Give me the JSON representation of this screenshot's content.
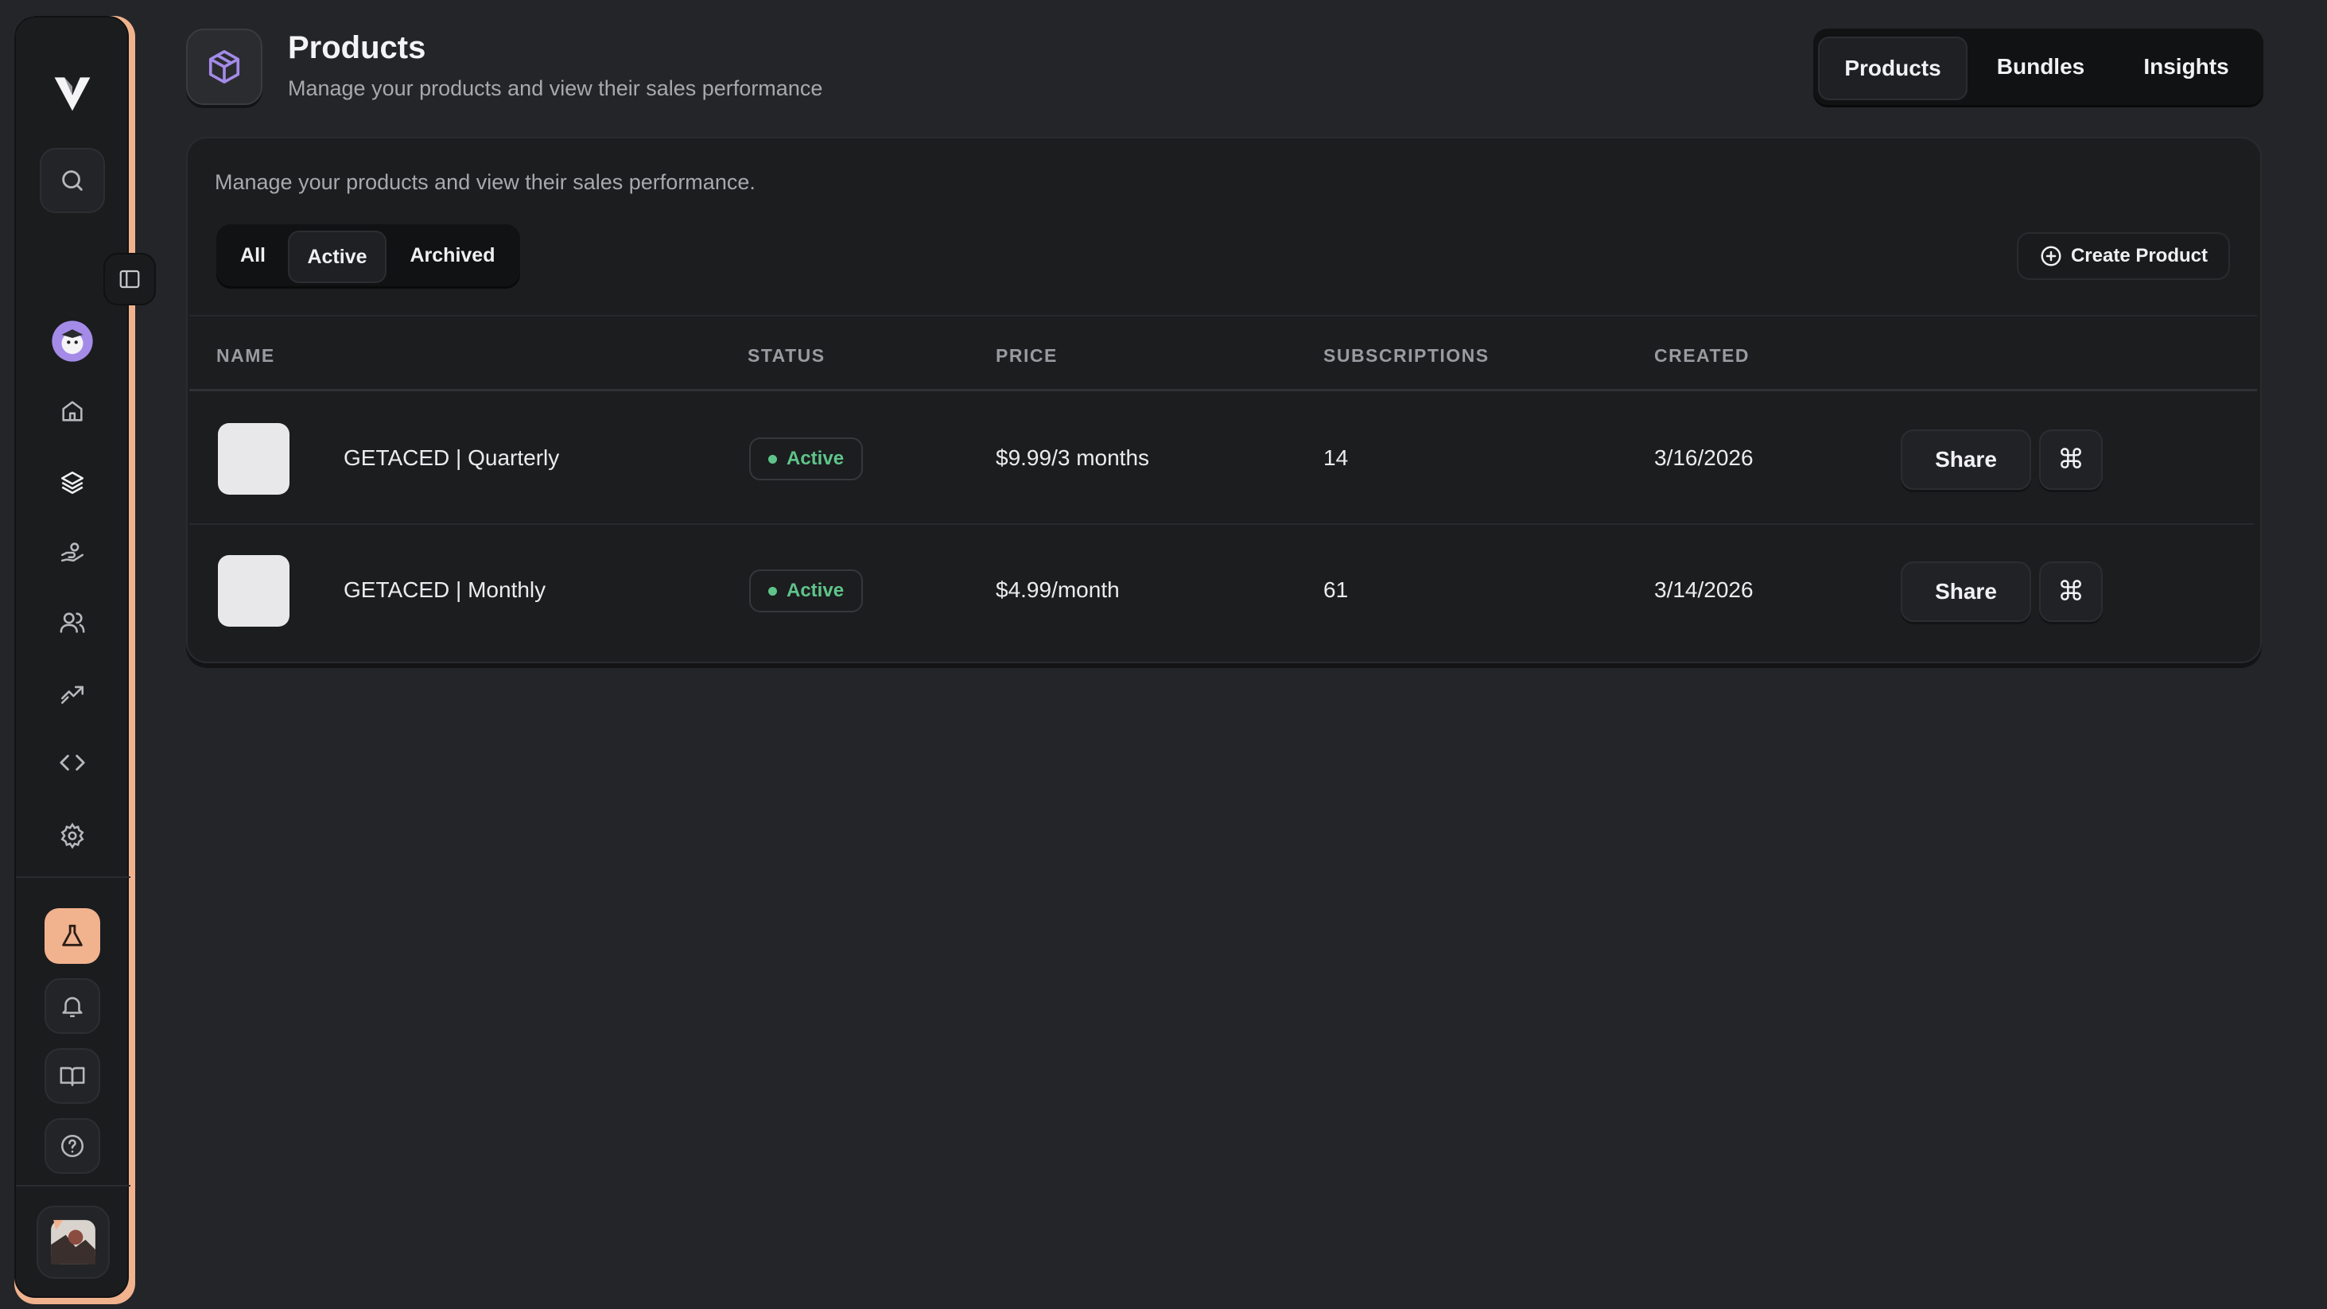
{
  "header": {
    "title": "Products",
    "subtitle": "Manage your products and view their sales performance"
  },
  "top_tabs": [
    {
      "label": "Products",
      "selected": true
    },
    {
      "label": "Bundles",
      "selected": false
    },
    {
      "label": "Insights",
      "selected": false
    }
  ],
  "card": {
    "description": "Manage your products and view their sales performance.",
    "filters": [
      {
        "label": "All",
        "selected": false
      },
      {
        "label": "Active",
        "selected": true
      },
      {
        "label": "Archived",
        "selected": false
      }
    ],
    "create_label": "Create Product"
  },
  "table": {
    "columns": [
      "NAME",
      "STATUS",
      "PRICE",
      "SUBSCRIPTIONS",
      "CREATED"
    ],
    "rows": [
      {
        "name": "GETACED | Quarterly",
        "status": "Active",
        "price": "$9.99/3 months",
        "subscriptions": "14",
        "created": "3/16/2026",
        "share": "Share",
        "cmd": "⌘"
      },
      {
        "name": "GETACED | Monthly",
        "status": "Active",
        "price": "$4.99/month",
        "subscriptions": "61",
        "created": "3/14/2026",
        "share": "Share",
        "cmd": "⌘"
      }
    ]
  },
  "sidebar": {
    "icons": [
      "logo-icon",
      "search-icon",
      "sidebar-toggle-icon",
      "avatar",
      "home-icon",
      "layers-icon",
      "handshake-icon",
      "users-icon",
      "trend-icon",
      "code-icon",
      "gear-icon",
      "flask-icon",
      "bell-icon",
      "book-icon",
      "help-icon",
      "user-avatar"
    ]
  },
  "colors": {
    "accent_orange": "#f1b28e",
    "status_green": "#5fc48a",
    "icon_purple": "#a48be8"
  }
}
